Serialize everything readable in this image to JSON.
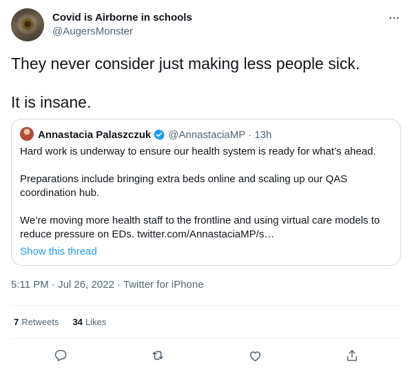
{
  "author": {
    "name": "Covid is Airborne in schools",
    "handle": "@AugersMonster"
  },
  "tweet": {
    "lines": [
      "They never consider just making less people sick.",
      "It is insane."
    ]
  },
  "quote": {
    "name": "Annastacia Palaszczuk",
    "handle": "@AnnastaciaMP",
    "time": "· 13h",
    "paragraphs": [
      [
        "Hard work is underway to ensure our health system is ready for what’s ahead."
      ],
      [
        "Preparations include bringing extra beds online and scaling up our QAS",
        "coordination hub."
      ],
      [
        "We’re moving more health staff to the frontline and using virtual care models to",
        "reduce pressure on EDs. twitter.com/AnnastaciaMP/s…"
      ]
    ],
    "show_thread": "Show this thread"
  },
  "timestamp": "5:11 PM · Jul 26, 2022 · Twitter for iPhone",
  "stats": {
    "retweets_count": "7",
    "retweets_label": "Retweets",
    "likes_count": "34",
    "likes_label": "Likes"
  },
  "icons": {
    "more": "more-horizontal-icon",
    "verified": "verified-badge-icon",
    "reply": "reply-icon",
    "retweet": "retweet-icon",
    "like": "like-icon",
    "share": "share-icon"
  },
  "colors": {
    "text": "#0f1419",
    "secondary": "#536471",
    "accent": "#1d9bf0",
    "border": "#cfd9de"
  }
}
